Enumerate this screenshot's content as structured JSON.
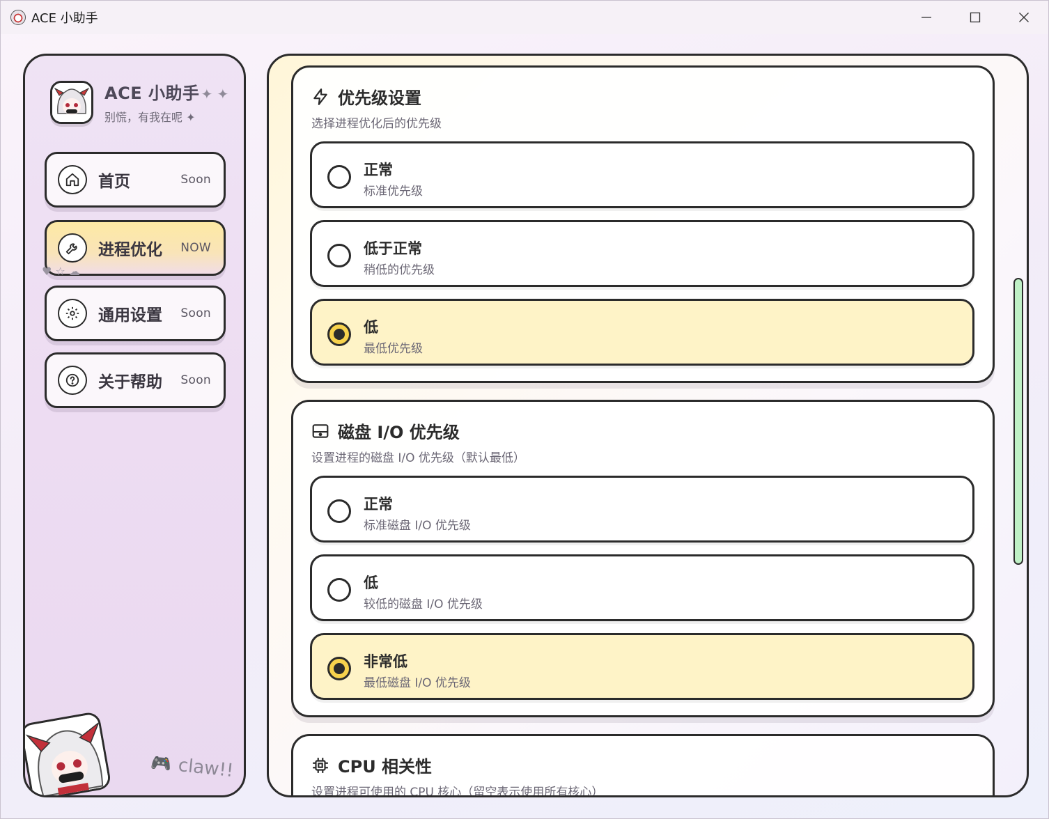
{
  "window": {
    "title": "ACE 小助手"
  },
  "brand": {
    "title": "ACE 小助手",
    "sparkle": "✦ ✦",
    "subtitle": "别慌，有我在呢 ✦"
  },
  "nav": [
    {
      "label": "首页",
      "badge": "Soon",
      "icon": "home-icon",
      "active": false
    },
    {
      "label": "进程优化",
      "badge": "NOW",
      "icon": "wrench-icon",
      "active": true
    },
    {
      "label": "通用设置",
      "badge": "Soon",
      "icon": "gear-icon",
      "active": false
    },
    {
      "label": "关于帮助",
      "badge": "Soon",
      "icon": "help-icon",
      "active": false
    }
  ],
  "sidebar_footer": {
    "claw_text": "claw!!"
  },
  "sections": {
    "priority": {
      "title": "优先级设置",
      "desc": "选择进程优化后的优先级",
      "icon": "lightning-icon",
      "options": [
        {
          "title": "正常",
          "sub": "标准优先级",
          "selected": false
        },
        {
          "title": "低于正常",
          "sub": "稍低的优先级",
          "selected": false
        },
        {
          "title": "低",
          "sub": "最低优先级",
          "selected": true
        }
      ]
    },
    "disk_io": {
      "title": "磁盘 I/O 优先级",
      "desc": "设置进程的磁盘 I/O 优先级（默认最低）",
      "icon": "disk-icon",
      "options": [
        {
          "title": "正常",
          "sub": "标准磁盘 I/O 优先级",
          "selected": false
        },
        {
          "title": "低",
          "sub": "较低的磁盘 I/O 优先级",
          "selected": false
        },
        {
          "title": "非常低",
          "sub": "最低磁盘 I/O 优先级",
          "selected": true
        }
      ]
    },
    "cpu": {
      "title": "CPU 相关性",
      "desc": "设置进程可使用的 CPU 核心（留空表示使用所有核心）",
      "icon": "cpu-icon"
    }
  },
  "colors": {
    "accent_yellow": "#fef3c7",
    "scroll_green": "#bff0c6",
    "border": "#2b2b2b"
  }
}
